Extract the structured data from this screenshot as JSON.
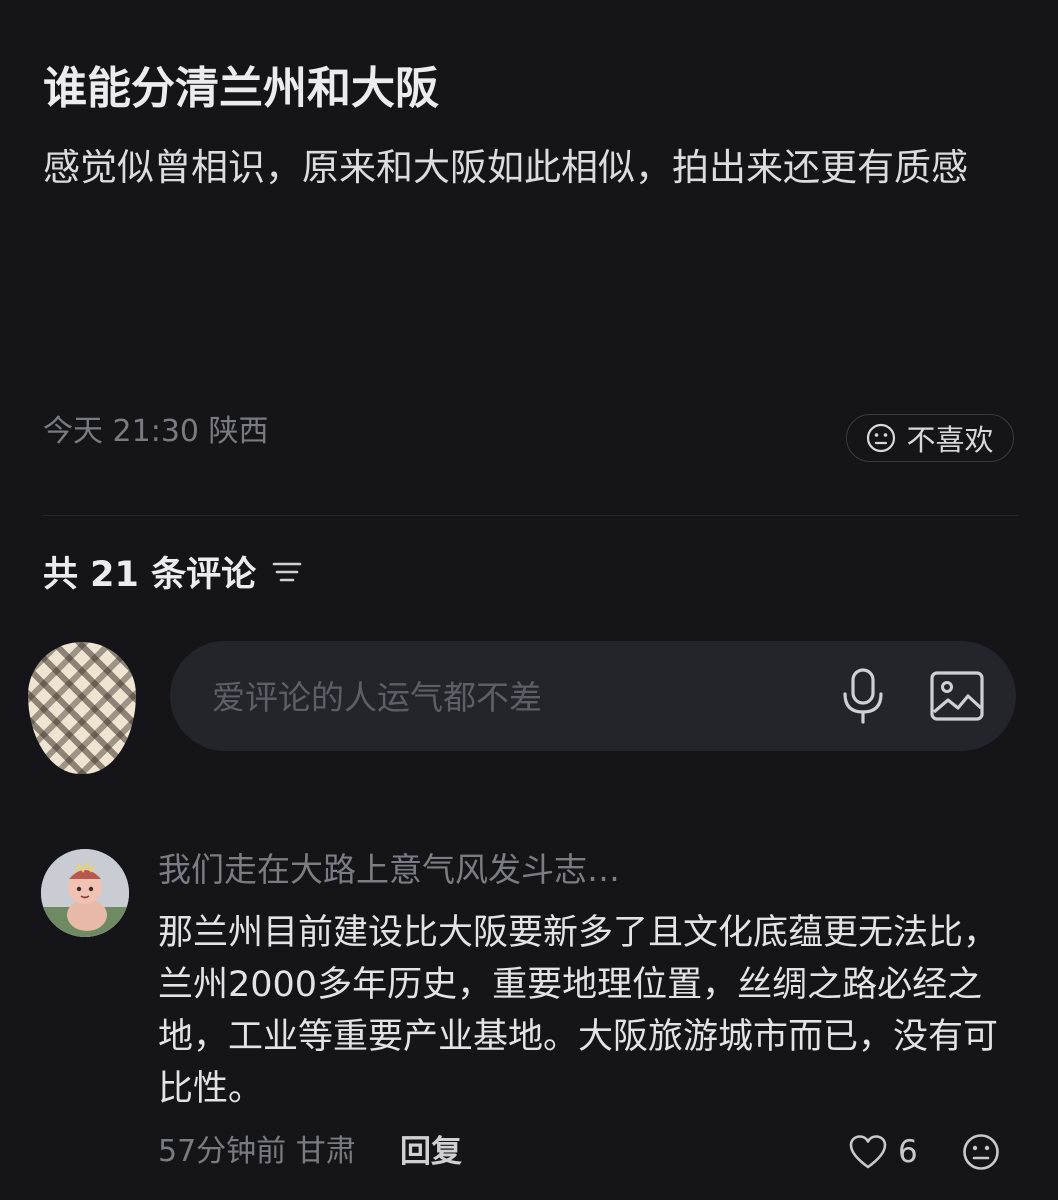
{
  "post": {
    "title": "谁能分清兰州和大阪",
    "body": "感觉似曾相识，原来和大阪如此相似，拍出来还更有质感",
    "meta": "今天 21:30 陕西",
    "dislike_label": "不喜欢"
  },
  "comments_header": {
    "count_label": "共 21 条评论"
  },
  "composer": {
    "placeholder": "爱评论的人运气都不差"
  },
  "comments": [
    {
      "username": "我们走在大路上意气风发斗志…",
      "text": "那兰州目前建设比大阪要新多了且文化底蕴更无法比，兰州2000多年历史，重要地理位置，丝绸之路必经之地，工业等重要产业基地。大阪旅游城市而已，没有可比性。",
      "meta": "57分钟前 甘肃",
      "reply_label": "回复",
      "likes": "6"
    }
  ],
  "icons": {
    "dislike": "neutral-face-icon",
    "sort": "sort-lines-icon",
    "mic": "mic-icon",
    "image": "image-icon",
    "like": "heart-icon"
  },
  "colors": {
    "background": "#141419",
    "input_bg": "#24242b",
    "muted_text": "#7a7a82"
  }
}
